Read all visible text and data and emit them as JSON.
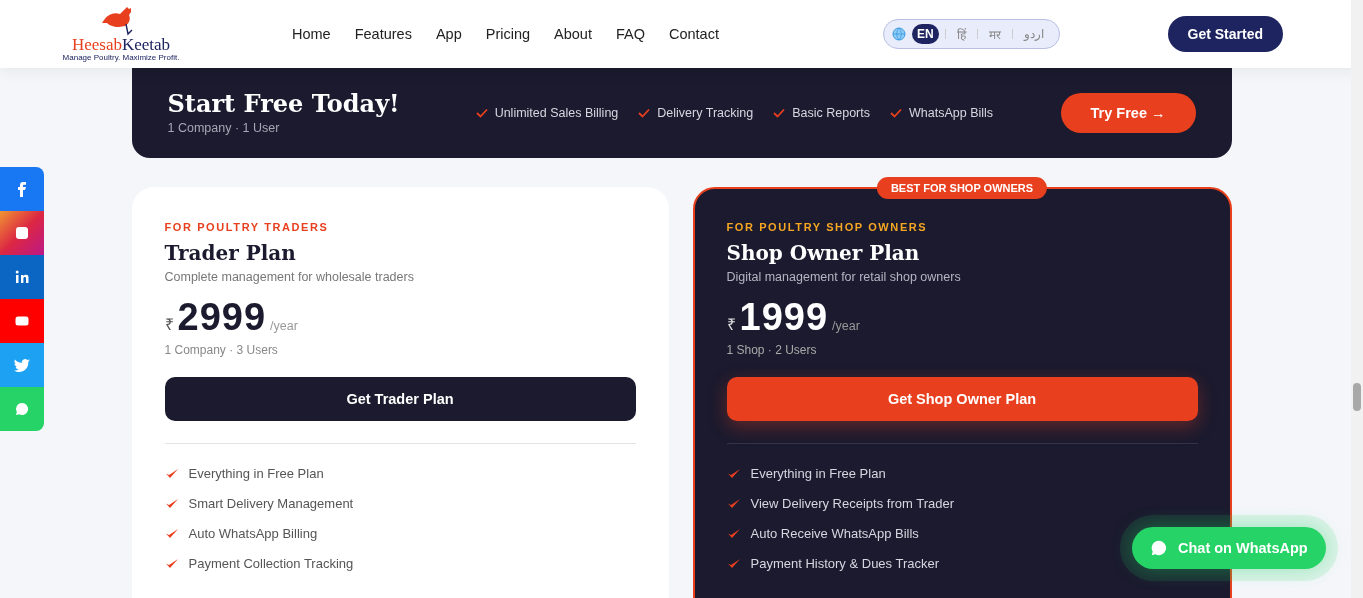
{
  "header": {
    "logo": {
      "parts": [
        "Heesab",
        "Keetab"
      ],
      "tagline": "Manage Poultry. Maximize Profit."
    },
    "nav": [
      {
        "label": "Home"
      },
      {
        "label": "Features"
      },
      {
        "label": "App"
      },
      {
        "label": "Pricing"
      },
      {
        "label": "About"
      },
      {
        "label": "FAQ"
      },
      {
        "label": "Contact"
      }
    ],
    "languages": [
      {
        "label": "EN",
        "selected": true
      },
      {
        "label": "हिं",
        "selected": false
      },
      {
        "label": "मर",
        "selected": false
      },
      {
        "label": "اردو",
        "selected": false
      }
    ],
    "cta": "Get Started"
  },
  "free_banner": {
    "title": "Start Free Today!",
    "subtitle": "1 Company · 1 User",
    "features": [
      "Unlimited Sales Billing",
      "Delivery Tracking",
      "Basic Reports",
      "WhatsApp Bills"
    ],
    "button": "Try Free →"
  },
  "plans": [
    {
      "featured": false,
      "eyebrow": "FOR POULTRY TRADERS",
      "name": "Trader Plan",
      "description": "Complete management for wholesale traders",
      "currency": "₹",
      "price": "2999",
      "period": "/year",
      "limits": "1 Company · 3 Users",
      "button": "Get Trader Plan",
      "features": [
        "Everything in Free Plan",
        "Smart Delivery Management",
        "Auto WhatsApp Billing",
        "Payment Collection Tracking"
      ]
    },
    {
      "featured": true,
      "badge": "BEST FOR SHOP OWNERS",
      "eyebrow": "FOR POULTRY SHOP OWNERS",
      "name": "Shop Owner Plan",
      "description": "Digital management for retail shop owners",
      "currency": "₹",
      "price": "1999",
      "period": "/year",
      "limits": "1 Shop · 2 Users",
      "button": "Get Shop Owner Plan",
      "features": [
        "Everything in Free Plan",
        "View Delivery Receipts from Trader",
        "Auto Receive WhatsApp Bills",
        "Payment History & Dues Tracker"
      ]
    }
  ],
  "social": [
    {
      "kind": "facebook"
    },
    {
      "kind": "instagram"
    },
    {
      "kind": "linkedin"
    },
    {
      "kind": "youtube"
    },
    {
      "kind": "twitter"
    },
    {
      "kind": "chat"
    }
  ],
  "whatsapp_button": "Chat on WhatsApp"
}
